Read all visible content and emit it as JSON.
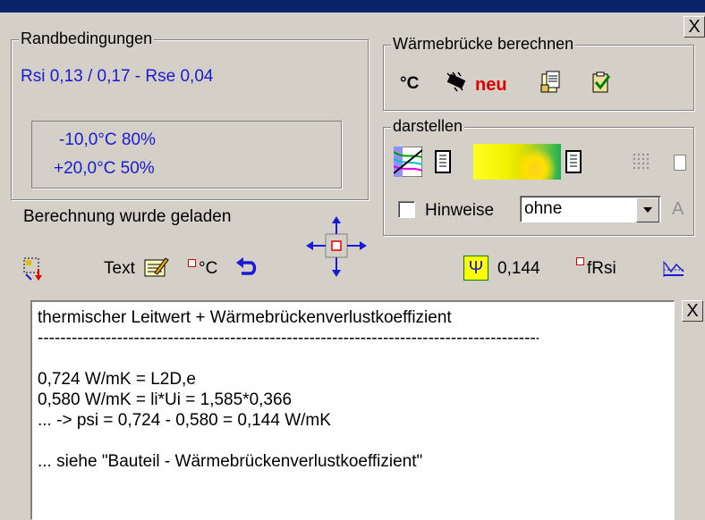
{
  "window": {
    "close_glyph": "X"
  },
  "randbedingungen": {
    "legend": "Randbedingungen",
    "resistances": "Rsi 0,13 / 0,17 - Rse 0,04",
    "climate_out": "-10,0°C 80%",
    "climate_in": "+20,0°C 50%"
  },
  "status": {
    "text": "Berechnung wurde geladen"
  },
  "waermebruecke": {
    "legend": "Wärmebrücke berechnen",
    "celsius_label": "°C",
    "neu_label": "neu"
  },
  "darstellen": {
    "legend": "darstellen",
    "hinweise_label": "Hinweise",
    "hinweise_checked": false,
    "grid_checked": false,
    "select_value": "ohne",
    "font_glyph": "A"
  },
  "toolbar": {
    "text_label": "Text",
    "celsius_label": "°C",
    "psi_symbol": "Ψ",
    "psi_value": "0,144",
    "frsi_label": "fRsi"
  },
  "output": {
    "lines": [
      "thermischer Leitwert + Wärmebrückenverlustkoeffizient",
      "--------------------------------------------------------------------------------------------",
      "",
      "0,724 W/mK = L2D,e",
      "0,580 W/mK = li*Ui = 1,585*0,366",
      "... -> psi = 0,724 - 0,580 = 0,144 W/mK",
      "",
      "... siehe \"Bauteil - Wärmebrückenverlustkoeffizient\""
    ]
  },
  "colors": {
    "titlebar": "#0a246a",
    "accent_blue": "#1a1ad4",
    "neu_red": "#e00000",
    "psi_bg": "#ffff00"
  }
}
